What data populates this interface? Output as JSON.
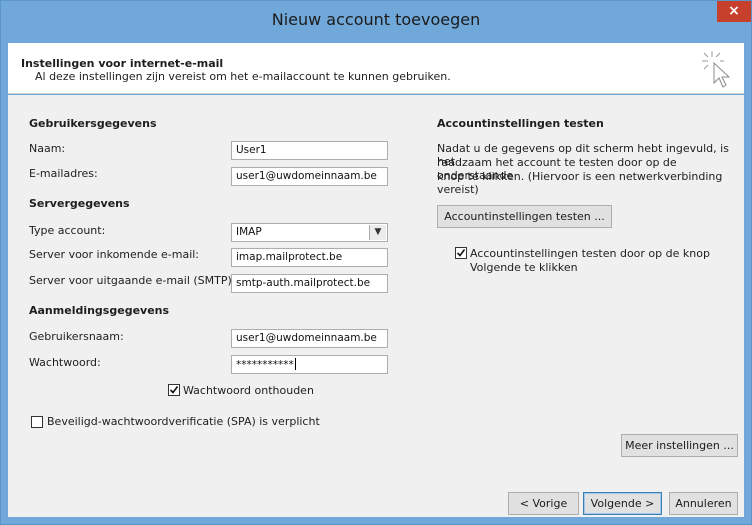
{
  "window": {
    "title": "Nieuw account toevoegen",
    "close_glyph": "×"
  },
  "header": {
    "title": "Instellingen voor internet-e-mail",
    "subtitle": "Al deze instellingen zijn vereist om het e-mailaccount te kunnen gebruiken."
  },
  "user_info": {
    "section": "Gebruikersgegevens",
    "name_label": "Naam:",
    "name_value": "User1",
    "email_label": "E-mailadres:",
    "email_value": "user1@uwdomeinnaam.be"
  },
  "server_info": {
    "section": "Servergegevens",
    "type_label": "Type account:",
    "type_value": "IMAP",
    "incoming_label": "Server voor inkomende e-mail:",
    "incoming_value": "imap.mailprotect.be",
    "outgoing_label": "Server voor uitgaande e-mail (SMTP):",
    "outgoing_value": "smtp-auth.mailprotect.be"
  },
  "login_info": {
    "section": "Aanmeldingsgegevens",
    "username_label": "Gebruikersnaam:",
    "username_value": "user1@uwdomeinnaam.be",
    "password_label": "Wachtwoord:",
    "password_value": "***********",
    "remember_label": "Wachtwoord onthouden",
    "remember_checked": true,
    "spa_label": "Beveiligd-wachtwoordverificatie (SPA) is verplicht",
    "spa_checked": false
  },
  "test": {
    "section": "Accountinstellingen testen",
    "description_line1": "Nadat u de gegevens op dit scherm hebt ingevuld, is het",
    "description_line2": "raadzaam het account te testen door op de onderstaande",
    "description_line3": "knop te klikken. (Hiervoor is een netwerkverbinding vereist)",
    "button_label": "Accountinstellingen testen ...",
    "auto_test_line1": "Accountinstellingen testen door op de knop",
    "auto_test_line2": "Volgende te klikken",
    "auto_test_checked": true
  },
  "buttons": {
    "more_settings": "Meer instellingen ...",
    "back": "< Vorige",
    "next": "Volgende >",
    "cancel": "Annuleren"
  },
  "colors": {
    "titlebar": "#70a8d9",
    "close": "#c7402c",
    "content_bg": "#f0f0f0"
  }
}
